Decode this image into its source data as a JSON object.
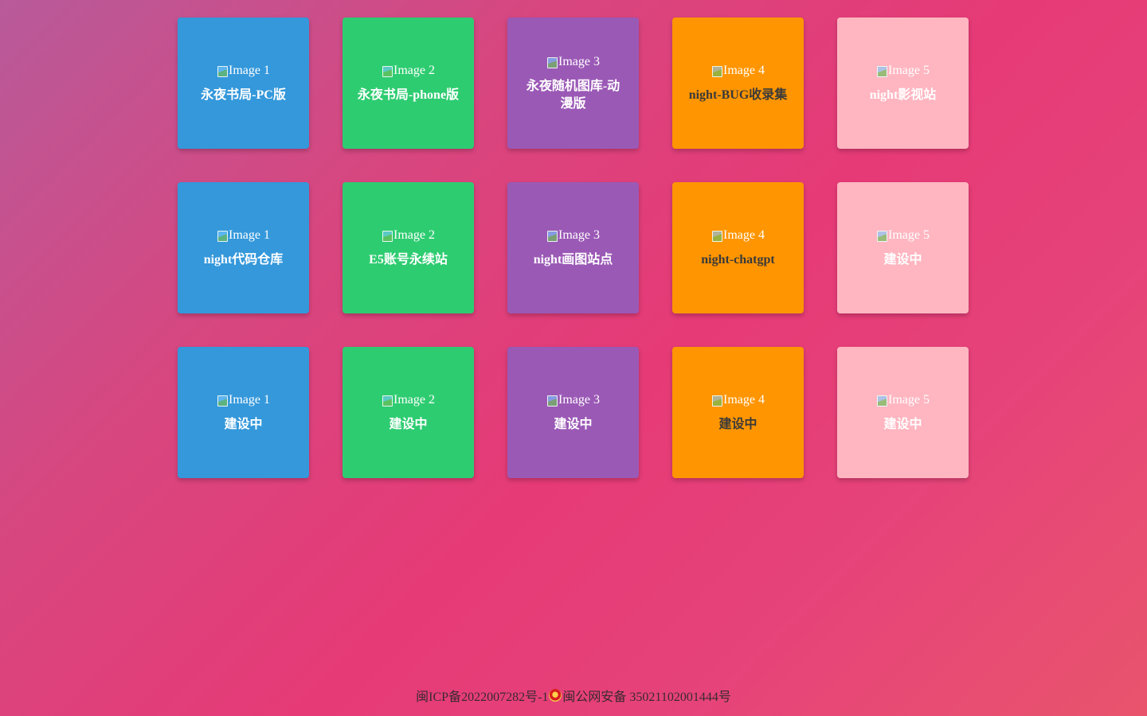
{
  "cards": [
    {
      "alt": "Image 1",
      "label": "永夜书局-PC版",
      "color": "#3498db"
    },
    {
      "alt": "Image 2",
      "label": "永夜书局-phone版",
      "color": "#2ecc71"
    },
    {
      "alt": "Image 3",
      "label": "永夜随机图库-动漫版",
      "color": "#9b59b6"
    },
    {
      "alt": "Image 4",
      "label": "night-BUG收录集",
      "color": "#ff9500"
    },
    {
      "alt": "Image 5",
      "label": "night影视站",
      "color": "#ffb6c1"
    },
    {
      "alt": "Image 1",
      "label": "night代码仓库",
      "color": "#3498db"
    },
    {
      "alt": "Image 2",
      "label": "E5账号永续站",
      "color": "#2ecc71"
    },
    {
      "alt": "Image 3",
      "label": "night画图站点",
      "color": "#9b59b6"
    },
    {
      "alt": "Image 4",
      "label": "night-chatgpt",
      "color": "#ff9500"
    },
    {
      "alt": "Image 5",
      "label": "建设中",
      "color": "#ffb6c1"
    },
    {
      "alt": "Image 1",
      "label": "建设中",
      "color": "#3498db"
    },
    {
      "alt": "Image 2",
      "label": "建设中",
      "color": "#2ecc71"
    },
    {
      "alt": "Image 3",
      "label": "建设中",
      "color": "#9b59b6"
    },
    {
      "alt": "Image 4",
      "label": "建设中",
      "color": "#ff9500"
    },
    {
      "alt": "Image 5",
      "label": "建设中",
      "color": "#ffb6c1"
    }
  ],
  "footer": {
    "icp": "闽ICP备2022007282号-1",
    "police": "闽公网安备 35021102001444号"
  }
}
